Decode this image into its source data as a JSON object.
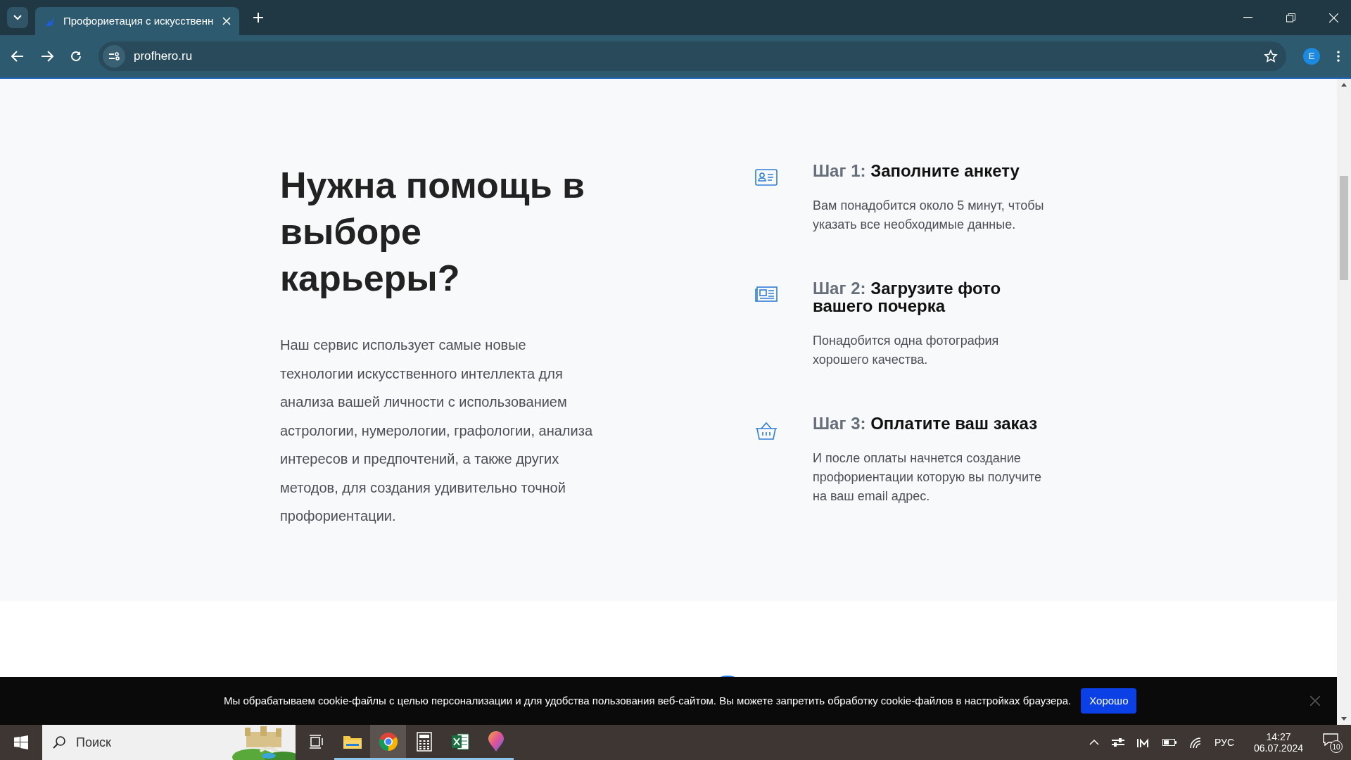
{
  "browser": {
    "tab": {
      "title": "Профориетация с искусственн",
      "selected": true
    },
    "url": "profhero.ru",
    "profile": "E"
  },
  "hero": {
    "heading": "Нужна помощь в выборе карьеры?",
    "text": "Наш сервис использует самые новые технологии искусственного интеллекта для анализа вашей личности с использованием астрологии, нумерологии, графологии, анализа интересов и предпочтений, а также других методов, для создания удивительно точной профориентации."
  },
  "steps": [
    {
      "kind": "form",
      "label": "Шаг 1:",
      "title": "Заполните анкету",
      "text": "Вам понадобится около 5 минут, чтобы указать все необходимые данные."
    },
    {
      "label": "Шаг 2:",
      "title": "Загрузите фото вашего почерка",
      "text": "Понадобится одна фотография хорошего качества."
    },
    {
      "kind": "basket",
      "label": "Шаг 3:",
      "title": "Оплатите ваш заказ",
      "text": "И после оплаты начнется создание профориентации которую вы получите на ваш email адрес."
    }
  ],
  "cookie_bar": {
    "text": "Мы обрабатываем cookie-файлы с целью персонализации и для удобства пользования веб-сайтом. Вы можете запретить обработку cookie-файлов в настройках браузера.",
    "button": "Хорошо"
  },
  "taskbar": {
    "search_placeholder": "Поиск",
    "apps": [
      {
        "kind": "taskview",
        "active": false
      },
      {
        "kind": "explorer",
        "active": false
      },
      {
        "kind": "chrome",
        "active": true
      },
      {
        "kind": "calculator",
        "active": false
      },
      {
        "kind": "excel",
        "active": false
      },
      {
        "kind": "paint",
        "active": false
      }
    ],
    "language": "РУС",
    "time": "14:27",
    "date": "06.07.2024",
    "notifications": "10"
  }
}
